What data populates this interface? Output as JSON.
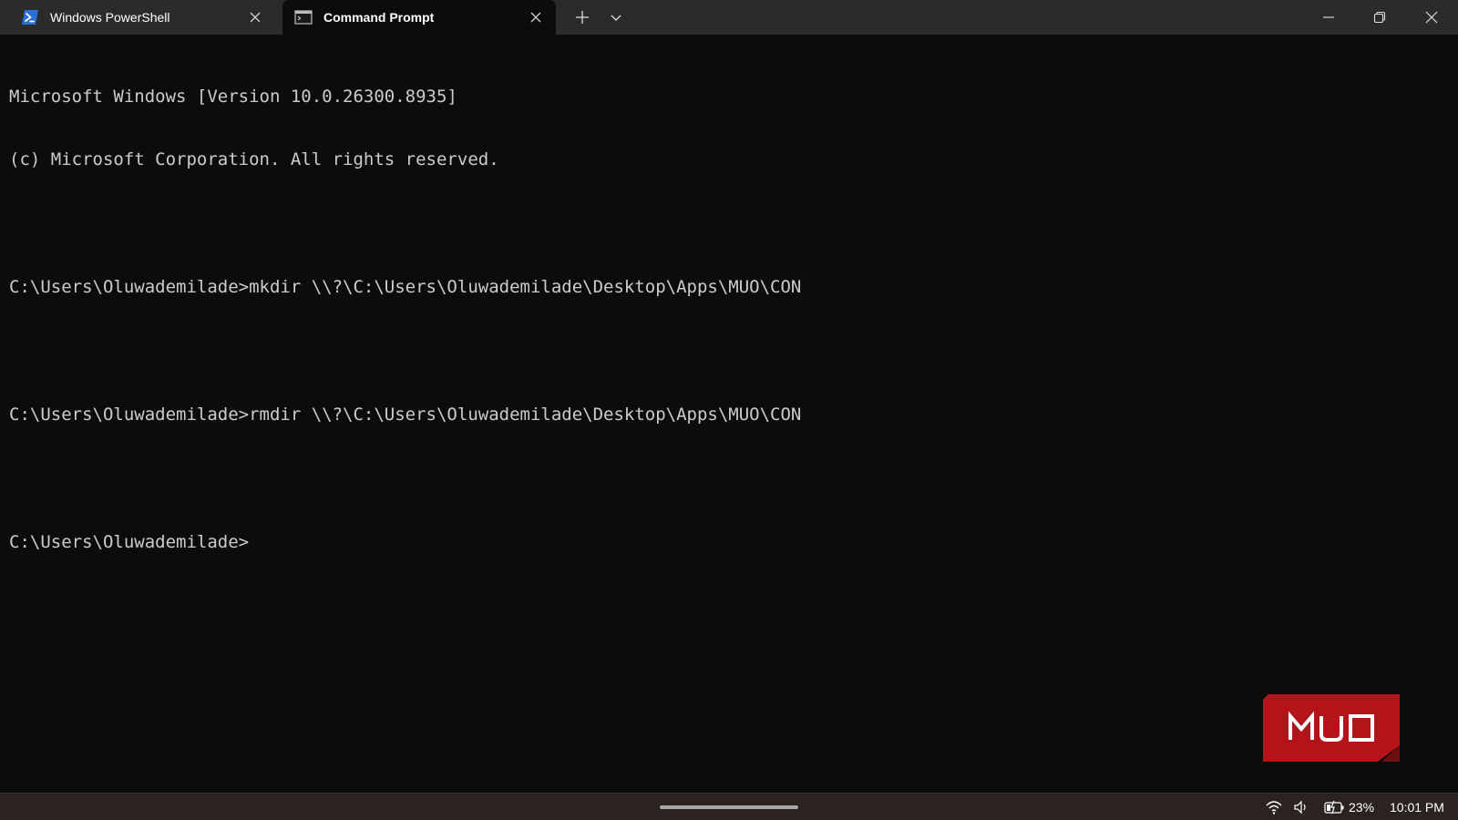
{
  "tabs": [
    {
      "label": "Windows PowerShell",
      "icon": "powershell-icon",
      "active": false
    },
    {
      "label": "Command Prompt",
      "icon": "cmd-icon",
      "active": true
    }
  ],
  "titlebar": {
    "new_tab": "plus-icon",
    "dropdown": "chevron-down-icon",
    "window_controls": [
      "minimize-icon",
      "restore-icon",
      "close-icon"
    ]
  },
  "console": {
    "lines": [
      "Microsoft Windows [Version 10.0.26300.8935]",
      "(c) Microsoft Corporation. All rights reserved.",
      "",
      "C:\\Users\\Oluwademilade>mkdir \\\\?\\C:\\Users\\Oluwademilade\\Desktop\\Apps\\MUO\\CON",
      "",
      "C:\\Users\\Oluwademilade>rmdir \\\\?\\C:\\Users\\Oluwademilade\\Desktop\\Apps\\MUO\\CON",
      "",
      "C:\\Users\\Oluwademilade>"
    ]
  },
  "watermark": {
    "text": "MUO",
    "color": "#b5151a"
  },
  "taskbar": {
    "battery": "23%",
    "time": "10:01 PM",
    "icons": [
      "wifi-icon",
      "volume-icon",
      "battery-charging-icon"
    ]
  },
  "colors": {
    "console_bg": "#0c0c0c",
    "console_text": "#cccccc",
    "titlebar_bg": "#2b2b2b",
    "powershell_blue": "#2a6fd6"
  }
}
